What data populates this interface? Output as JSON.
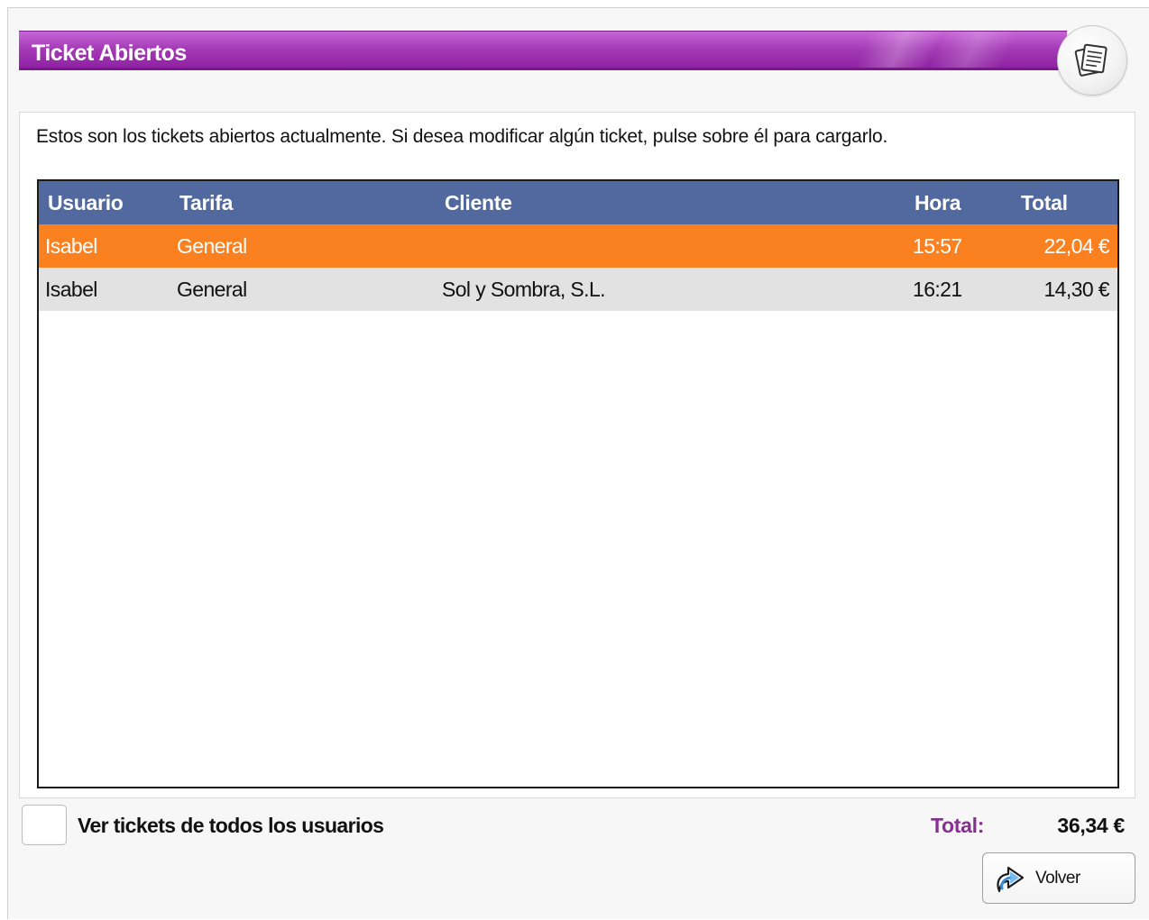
{
  "window": {
    "title": "Ticket Abiertos",
    "title_icon": "tickets-stack-icon"
  },
  "intro_text": "Estos son los tickets abiertos actualmente. Si desea modificar algún ticket, pulse sobre él para cargarlo.",
  "table": {
    "columns": {
      "usuario": "Usuario",
      "tarifa": "Tarifa",
      "cliente": "Cliente",
      "hora": "Hora",
      "total": "Total"
    },
    "rows": [
      {
        "usuario": "Isabel",
        "tarifa": "General",
        "cliente": "",
        "hora": "15:57",
        "total": "22,04 €",
        "selected": true
      },
      {
        "usuario": "Isabel",
        "tarifa": "General",
        "cliente": "Sol y Sombra, S.L.",
        "hora": "16:21",
        "total": "14,30 €",
        "selected": false
      }
    ]
  },
  "footer": {
    "all_users_checkbox_label": "Ver tickets de todos los usuarios",
    "all_users_checked": false,
    "total_label": "Total:",
    "total_value": "36,34 €",
    "back_button_label": "Volver",
    "back_button_icon": "return-arrow-icon"
  },
  "colors": {
    "title_bar": "#a43ab6",
    "header_row": "#51699e",
    "selected_row": "#fb8120",
    "alt_row": "#e2e2e2",
    "total_label": "#86308f"
  }
}
